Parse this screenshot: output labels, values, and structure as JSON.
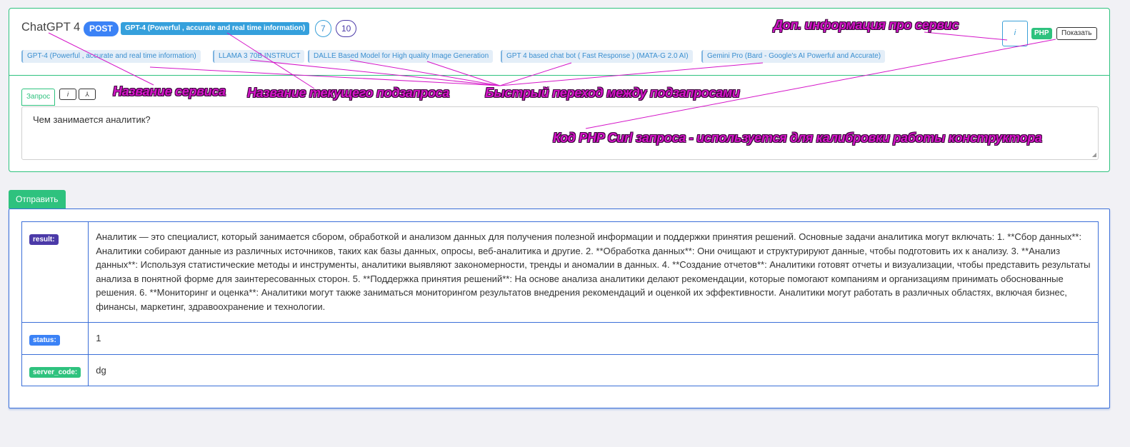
{
  "service": {
    "name": "ChatGPT 4",
    "method": "POST",
    "current_subrequest": "GPT-4 (Powerful , accurate and real time information)",
    "counts": [
      "7",
      "10"
    ],
    "info_icon": "i",
    "php_label": "PHP",
    "show_label": "Показать"
  },
  "subrequests": [
    "GPT-4 (Powerful , accurate and real time information)",
    "LLAMA 3 70B INSTRUCT",
    "DALLE Based Model for High quality Image Generation",
    "GPT 4 based chat bot ( Fast Response ) (MATA-G 2.0 AI)",
    "Gemini Pro (Bard - Google's AI Powerful and Accurate)"
  ],
  "request": {
    "tab_label": "Запрос",
    "info_icon": "i",
    "tree_icon": "⅄",
    "value": "Чем занимается аналитик?"
  },
  "send_label": "Отправить",
  "result_rows": [
    {
      "key": "result:",
      "value": "Аналитик — это специалист, который занимается сбором, обработкой и анализом данных для получения полезной информации и поддержки принятия решений. Основные задачи аналитика могут включать: 1. **Сбор данных**: Аналитики собирают данные из различных источников, таких как базы данных, опросы, веб-аналитика и другие. 2. **Обработка данных**: Они очищают и структурируют данные, чтобы подготовить их к анализу. 3. **Анализ данных**: Используя статистические методы и инструменты, аналитики выявляют закономерности, тренды и аномалии в данных. 4. **Создание отчетов**: Аналитики готовят отчеты и визуализации, чтобы представить результаты анализа в понятной форме для заинтересованных сторон. 5. **Поддержка принятия решений**: На основе анализа аналитики делают рекомендации, которые помогают компаниям и организациям принимать обоснованные решения. 6. **Мониторинг и оценка**: Аналитики могут также заниматься мониторингом результатов внедрения рекомендаций и оценкой их эффективности. Аналитики могут работать в различных областях, включая бизнес, финансы, маркетинг, здравоохранение и технологии."
    },
    {
      "key": "status:",
      "value": "1"
    },
    {
      "key": "server_code:",
      "value": "dg"
    }
  ],
  "annotations": {
    "service_name": "Название сервиса",
    "current_subrequest": "Название текущего подзапроса",
    "quick_switch": "Быстрый переход между подзапросами",
    "extra_info": "Доп. информация про сервис",
    "php_code": "Код PHP Curl запроса - используется для калибровки работы конструктора"
  },
  "colors": {
    "accent_green": "#2ec27e",
    "accent_blue": "#3b82f6",
    "accent_purple": "#4b3aa8",
    "annotation_magenta": "#d414c8"
  }
}
